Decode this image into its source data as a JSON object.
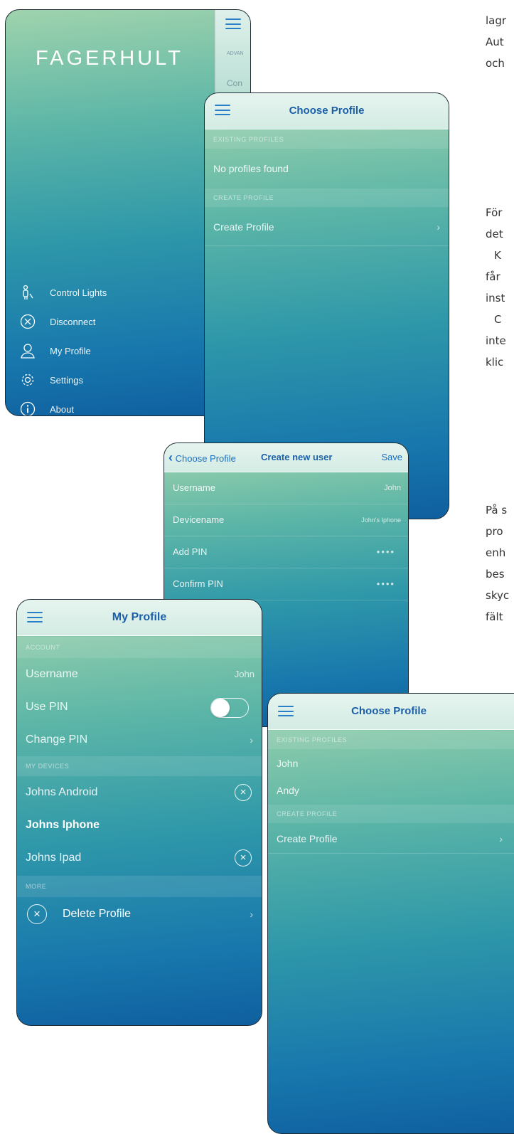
{
  "side_text": {
    "lines_top": [
      "lagr",
      "Aut",
      "och"
    ],
    "lines_mid": [
      "För",
      "det",
      "K",
      "får",
      "inst",
      "C",
      "inte",
      "klic"
    ],
    "lines_low": [
      "På s",
      "pro",
      "enh",
      "bes",
      "skyc",
      "fält"
    ]
  },
  "menu_screen": {
    "logo": "FAGERHULT",
    "peek_section": "ADVAN",
    "peek_item": "Con",
    "items": [
      {
        "label": "Control Lights",
        "icon": "person-light-icon"
      },
      {
        "label": "Disconnect",
        "icon": "close-circle-icon"
      },
      {
        "label": "My Profile",
        "icon": "user-icon"
      },
      {
        "label": "Settings",
        "icon": "gear-icon"
      },
      {
        "label": "About",
        "icon": "info-icon"
      }
    ]
  },
  "choose_profile_empty": {
    "title": "Choose Profile",
    "existing_section": "EXISTING PROFILES",
    "empty_text": "No profiles found",
    "create_section": "CREATE PROFILE",
    "create_label": "Create Profile"
  },
  "create_user": {
    "back_label": "Choose Profile",
    "title": "Create new user",
    "save_label": "Save",
    "fields": [
      {
        "label": "Username",
        "value": "John"
      },
      {
        "label": "Devicename",
        "value": "John's Iphone"
      },
      {
        "label": "Add PIN",
        "value": "••••"
      },
      {
        "label": "Confirm PIN",
        "value": "••••"
      }
    ]
  },
  "my_profile": {
    "title": "My Profile",
    "account_section": "ACCOUNT",
    "username_label": "Username",
    "username_value": "John",
    "use_pin_label": "Use PIN",
    "use_pin_on": false,
    "change_pin_label": "Change PIN",
    "devices_section": "MY DEVICES",
    "devices": [
      {
        "name": "Johns Android",
        "removable": true
      },
      {
        "name": "Johns Iphone",
        "removable": false
      },
      {
        "name": "Johns Ipad",
        "removable": true
      }
    ],
    "more_section": "MORE",
    "delete_label": "Delete Profile"
  },
  "choose_profile_filled": {
    "title": "Choose Profile",
    "existing_section": "EXISTING PROFILES",
    "profiles": [
      "John",
      "Andy"
    ],
    "create_section": "CREATE PROFILE",
    "create_label": "Create Profile"
  }
}
